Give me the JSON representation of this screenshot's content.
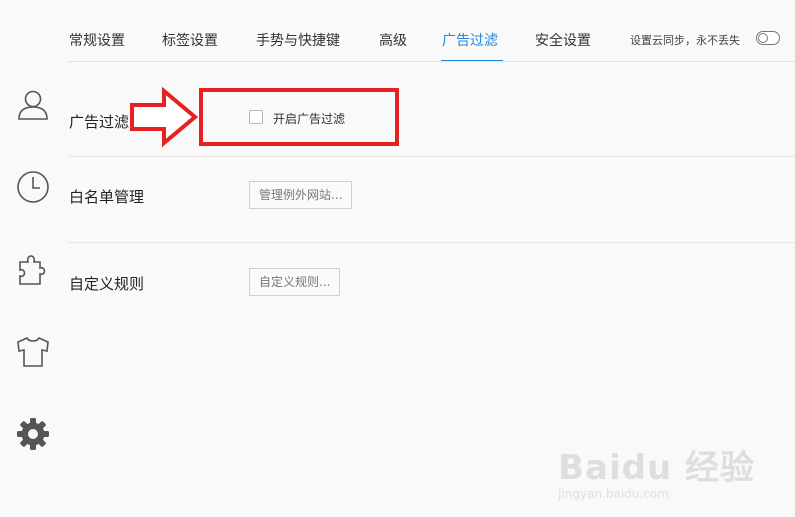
{
  "tabs": [
    {
      "label": "常规设置",
      "active": false
    },
    {
      "label": "标签设置",
      "active": false
    },
    {
      "label": "手势与快捷键",
      "active": false
    },
    {
      "label": "高级",
      "active": false
    },
    {
      "label": "广告过滤",
      "active": true
    },
    {
      "label": "安全设置",
      "active": false
    }
  ],
  "sync": {
    "label": "设置云同步，永不丢失",
    "enabled": false
  },
  "sidebar": {
    "icons": [
      "user-icon",
      "clock-icon",
      "puzzle-icon",
      "shirt-icon",
      "gear-icon"
    ]
  },
  "rows": {
    "ad_filter": {
      "label": "广告过滤",
      "checkbox_label": "开启广告过滤",
      "checked": false
    },
    "whitelist": {
      "label": "白名单管理",
      "button": "管理例外网站..."
    },
    "custom_rules": {
      "label": "自定义规则",
      "button": "自定义规则..."
    }
  },
  "colors": {
    "accent": "#1e88e5",
    "annotation": "#e52121"
  },
  "watermark": {
    "logo": "Baidu 经验",
    "url": "jingyan.baidu.com"
  }
}
